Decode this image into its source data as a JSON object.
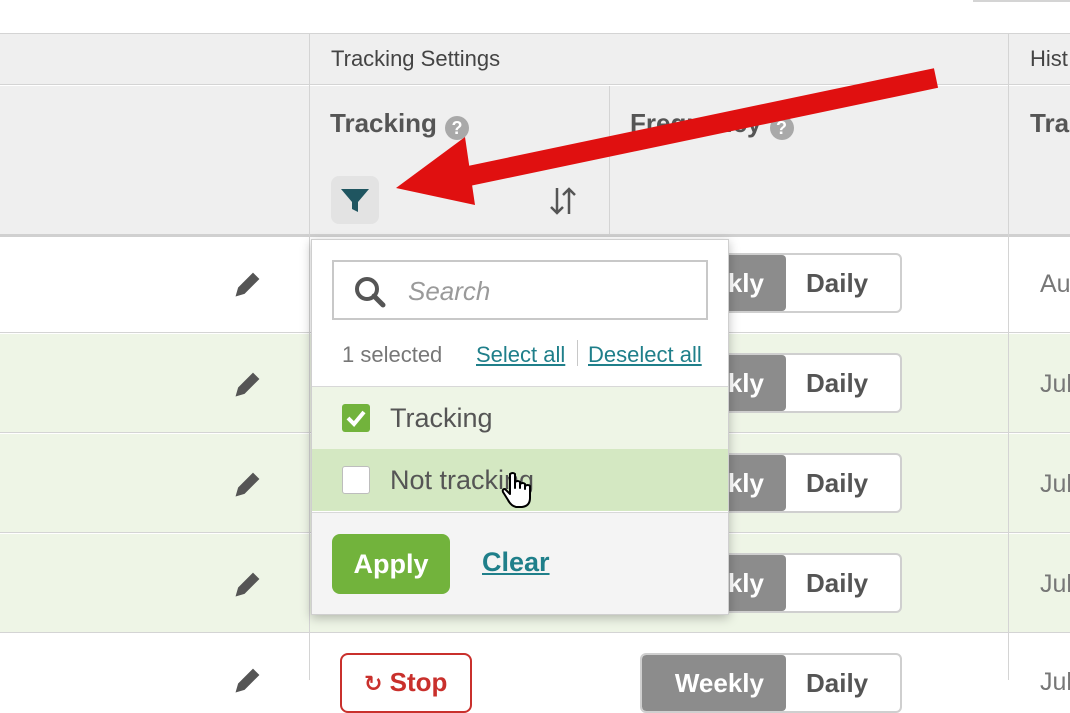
{
  "header": {
    "group_label": "Tracking Settings",
    "history_label": "Hist",
    "tracking_title": "Tracking",
    "frequency_title": "Frequency",
    "third_title": "Tra",
    "help_glyph": "?"
  },
  "rows": [
    {
      "weekly": "Weekly",
      "daily": "Daily",
      "history": "Au"
    },
    {
      "weekly": "Weekly",
      "daily": "Daily",
      "history": "Jul"
    },
    {
      "weekly": "Weekly",
      "daily": "Daily",
      "history": "Jul"
    },
    {
      "weekly": "Weekly",
      "daily": "Daily",
      "history": "Jul"
    },
    {
      "weekly": "Weekly",
      "daily": "Daily",
      "history": "Jul",
      "action": "Stop"
    }
  ],
  "filter_dropdown": {
    "search_placeholder": "Search",
    "selected_count": "1 selected",
    "select_all": "Select all",
    "deselect_all": "Deselect all",
    "options": [
      {
        "label": "Tracking",
        "checked": true
      },
      {
        "label": "Not tracking",
        "checked": false
      }
    ],
    "apply": "Apply",
    "clear": "Clear"
  },
  "colors": {
    "accent_green": "#72b33c",
    "link_teal": "#1f7f8a",
    "annotation_red": "#e01010",
    "row_highlight": "#eef5e6",
    "hover_row": "#d4e8c2"
  }
}
